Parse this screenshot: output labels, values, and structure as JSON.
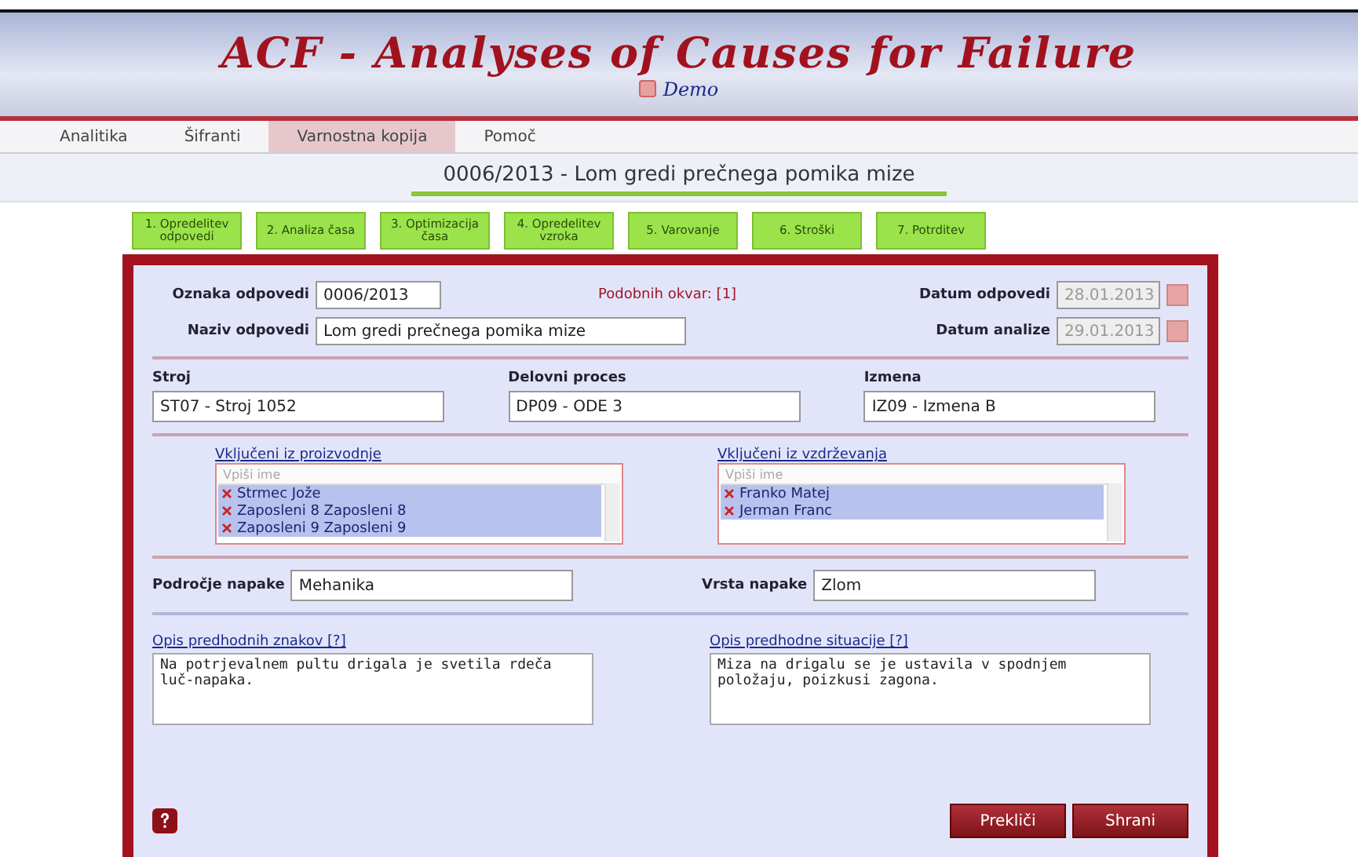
{
  "header": {
    "title": "ACF - Analyses of Causes for Failure",
    "subtitle": "Demo"
  },
  "menu": [
    {
      "label": "Analitika",
      "selected": false
    },
    {
      "label": "Šifranti",
      "selected": false
    },
    {
      "label": "Varnostna kopija",
      "selected": true
    },
    {
      "label": "Pomoč",
      "selected": false
    }
  ],
  "heading": "0006/2013 - Lom gredi prečnega pomika mize",
  "steps": [
    {
      "label": "1. Opredelitev odpovedi"
    },
    {
      "label": "2. Analiza časa"
    },
    {
      "label": "3. Optimizacija časa"
    },
    {
      "label": "4. Opredelitev vzroka"
    },
    {
      "label": "5. Varovanje"
    },
    {
      "label": "6. Stroški"
    },
    {
      "label": "7. Potrditev"
    }
  ],
  "form": {
    "oznaka": {
      "label": "Oznaka odpovedi",
      "value": "0006/2013"
    },
    "similar": "Podobnih okvar: [1]",
    "naziv": {
      "label": "Naziv odpovedi",
      "value": "Lom gredi prečnega pomika mize"
    },
    "datum_odpovedi": {
      "label": "Datum odpovedi",
      "value": "28.01.2013",
      "disabled": true
    },
    "datum_analize": {
      "label": "Datum analize",
      "value": "29.01.2013",
      "disabled": true
    },
    "selects": [
      {
        "label": "Stroj",
        "value": "ST07 - Stroj 1052"
      },
      {
        "label": "Delovni proces",
        "value": "DP09 - ODE 3"
      },
      {
        "label": "Izmena",
        "value": "IZ09 - Izmena B"
      }
    ],
    "lists": [
      {
        "label": "Vključeni iz proizvodnje",
        "placeholder": "Vpiši ime",
        "items": [
          {
            "name": "Strmec Jože",
            "selected": true
          },
          {
            "name": "Zaposleni 8 Zaposleni 8",
            "selected": true
          },
          {
            "name": "Zaposleni 9 Zaposleni 9",
            "selected": true
          }
        ]
      },
      {
        "label": "Vključeni iz vzdrževanja",
        "placeholder": "Vpiši ime",
        "items": [
          {
            "name": "Franko Matej",
            "selected": true
          },
          {
            "name": "Jerman Franc",
            "selected": true
          }
        ]
      }
    ],
    "area": {
      "label": "Področje napake",
      "value": "Mehanika"
    },
    "type": {
      "label": "Vrsta napake",
      "value": "Zlom"
    },
    "texts": [
      {
        "label": "Opis predhodnih znakov [?]",
        "value": "Na potrjevalnem pultu drigala je svetila rdeča luč-napaka."
      },
      {
        "label": "Opis predhodne situacije [?]",
        "value": "Miza na drigalu se je ustavila v spodnjem položaju, poizkusi zagona."
      }
    ],
    "buttons": [
      {
        "label": "Prekliči"
      },
      {
        "label": "Shrani"
      }
    ]
  }
}
